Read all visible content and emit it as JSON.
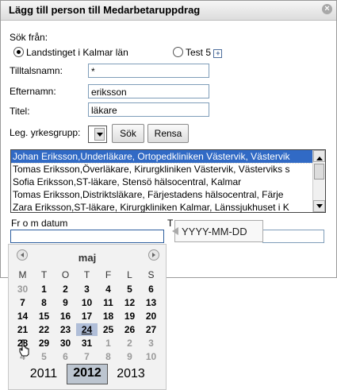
{
  "dialog": {
    "title": "Lägg till person till Medarbetaruppdrag",
    "close": "×"
  },
  "search": {
    "from_label": "Sök från:",
    "option1": "Landstinget i Kalmar län",
    "option2": "Test 5",
    "expand": "+"
  },
  "form": {
    "first_name_label": "Tilltalsnamn:",
    "first_name_value": "*",
    "last_name_label": "Efternamn:",
    "last_name_value": "eriksson",
    "title_label": "Titel:",
    "title_value": "läkare",
    "profession_label": "Leg. yrkesgrupp:",
    "search_button": "Sök",
    "clear_button": "Rensa"
  },
  "results": [
    "Johan Eriksson,Underläkare, Ortopedkliniken Västervik, Västervik",
    "Tomas Eriksson,Överläkare, Kirurgkliniken Västervik, Västerviks s",
    "Sofia Eriksson,ST-läkare, Stensö hälsocentral, Kalmar",
    "Tomas Eriksson,Distriktsläkare, Färjestadens hälsocentral, Färje",
    "Zara Eriksson,ST-läkare, Kirurgkliniken Kalmar, Länssjukhuset i K"
  ],
  "dates": {
    "from_label": "Fr o m datum",
    "to_label_partial": "T",
    "tooltip": "YYYY-MM-DD"
  },
  "calendar": {
    "month": "maj",
    "weekdays": [
      "M",
      "T",
      "O",
      "T",
      "F",
      "L",
      "S"
    ],
    "weeks": [
      [
        "30",
        "1",
        "2",
        "3",
        "4",
        "5",
        "6"
      ],
      [
        "7",
        "8",
        "9",
        "10",
        "11",
        "12",
        "13"
      ],
      [
        "14",
        "15",
        "16",
        "17",
        "18",
        "19",
        "20"
      ],
      [
        "21",
        "22",
        "23",
        "24",
        "25",
        "26",
        "27"
      ],
      [
        "28",
        "29",
        "30",
        "31",
        "1",
        "2",
        "3"
      ],
      [
        "4",
        "5",
        "6",
        "7",
        "8",
        "9",
        "10"
      ]
    ],
    "today": "24",
    "years": [
      "2011",
      "2012",
      "2013"
    ],
    "selected_year": "2012"
  }
}
